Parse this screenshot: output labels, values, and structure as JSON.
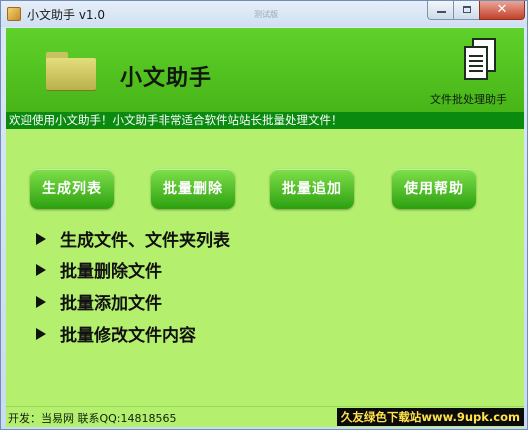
{
  "window": {
    "title": "小文助手 v1.0",
    "watermark_tab": "测试版",
    "close_glyph": "✕"
  },
  "banner": {
    "title": "小文助手",
    "subtitle": "文件批处理助手"
  },
  "marquee": {
    "text": "欢迎使用小文助手！小文助手非常适合软件站站长批量处理文件！"
  },
  "buttons": [
    {
      "label": "生成列表"
    },
    {
      "label": "批量删除"
    },
    {
      "label": "批量追加"
    },
    {
      "label": "使用帮助"
    }
  ],
  "features": [
    {
      "text": "生成文件、文件夹列表"
    },
    {
      "text": "批量删除文件"
    },
    {
      "text": "批量添加文件"
    },
    {
      "text": "批量修改文件内容"
    }
  ],
  "status": {
    "developer": "开发：当易网 联系QQ:14818565",
    "watermark": "久友绿色下载站www.9upk.com"
  },
  "colors": {
    "banner_green": "#4fc21f",
    "content_green": "#b4f06e",
    "marquee_green": "#0b8a10",
    "button_green": "#2ca010"
  }
}
